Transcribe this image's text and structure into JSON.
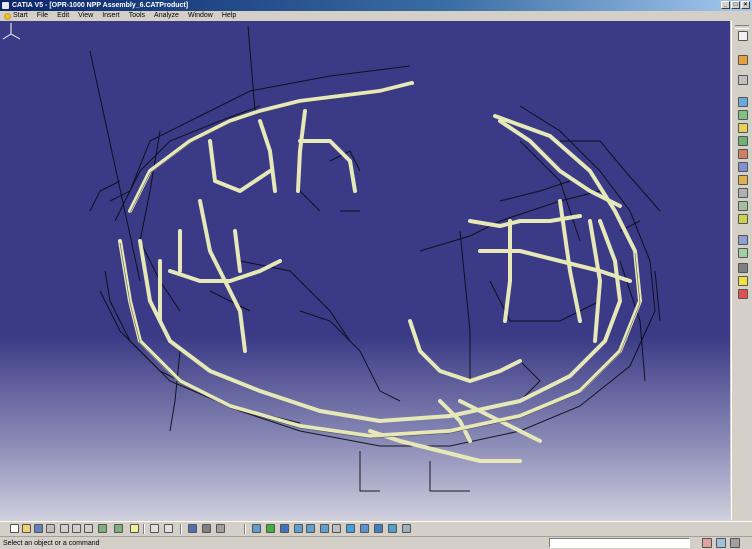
{
  "window": {
    "title": "CATIA V5 - [OPR-1000 NPP Assembly_6.CATProduct]"
  },
  "menubar": {
    "items": [
      "Start",
      "File",
      "Edit",
      "View",
      "Insert",
      "Tools",
      "Analyze",
      "Window",
      "Help"
    ]
  },
  "viewport": {
    "icon": "3d-piping-model"
  },
  "right_toolbar": {
    "icons": [
      "select-arrow-icon",
      "fly-mode-icon",
      "catalog-icon",
      "product-icon",
      "component-icon",
      "part-icon",
      "existing-component-icon",
      "replace-icon",
      "graph-tree-icon",
      "generate-numbering-icon",
      "selective-load-icon",
      "manage-representations-icon",
      "multi-instantiation-icon",
      "fast-multi-instantiation-icon",
      "reorder-icon",
      "constraint-icon",
      "bulb-icon",
      "delete-icon"
    ]
  },
  "bottom_toolbar": {
    "icons": [
      "new-icon",
      "open-icon",
      "save-icon",
      "print-icon",
      "cut-icon",
      "copy-icon",
      "paste-icon",
      "undo-icon",
      "redo-icon",
      "whats-this-icon",
      "formula-icon",
      "comment-icon",
      "catalog-browser-icon",
      "measure-icon",
      "apply-material-icon",
      "fit-all-icon",
      "pan-icon",
      "rotate-icon",
      "zoom-in-icon",
      "zoom-out-icon",
      "normal-view-icon",
      "iso-view-icon",
      "shading-icon",
      "hide-show-icon",
      "swap-space-icon",
      "multi-view-icon",
      "render-style-icon"
    ]
  },
  "statusbar": {
    "message": "Select an object or a command",
    "command_value": ""
  },
  "colors": {
    "viewport_top": "#3a3a86",
    "pipe": "#e6e8b8",
    "structure": "#101018"
  }
}
